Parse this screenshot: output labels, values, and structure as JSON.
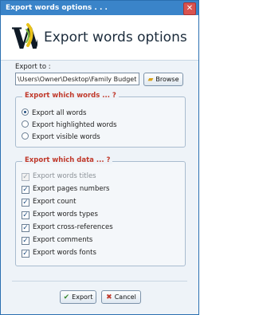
{
  "window": {
    "title": "Export words options . . ."
  },
  "header": {
    "title": "Export words options"
  },
  "export_to": {
    "label": "Export to :",
    "path_value": "\\Users\\Owner\\Desktop\\Family Budget.pdfig",
    "browse_label": "Browse"
  },
  "words_group": {
    "title": "Export which words ... ?",
    "options": [
      {
        "label": "Export all words",
        "selected": true
      },
      {
        "label": "Export highlighted words",
        "selected": false
      },
      {
        "label": "Export visible words",
        "selected": false
      }
    ]
  },
  "data_group": {
    "title": "Export which data ... ?",
    "options": [
      {
        "label": "Export words titles",
        "checked": true,
        "disabled": true
      },
      {
        "label": "Export pages numbers",
        "checked": true,
        "disabled": false
      },
      {
        "label": "Export count",
        "checked": true,
        "disabled": false
      },
      {
        "label": "Export words types",
        "checked": true,
        "disabled": false
      },
      {
        "label": "Export cross-references",
        "checked": true,
        "disabled": false
      },
      {
        "label": "Export comments",
        "checked": true,
        "disabled": false
      },
      {
        "label": "Export words fonts",
        "checked": true,
        "disabled": false
      }
    ]
  },
  "footer": {
    "export_label": "Export",
    "cancel_label": "Cancel"
  }
}
